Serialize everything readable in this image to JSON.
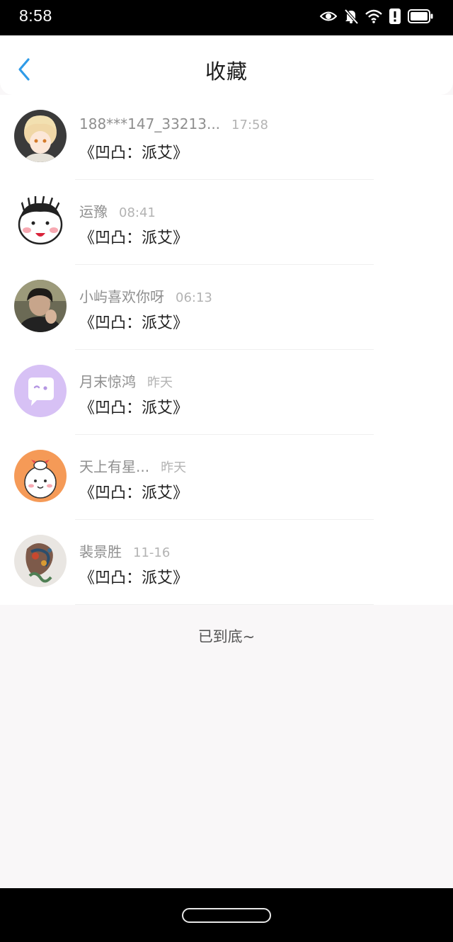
{
  "status_bar": {
    "time": "8:58",
    "icons": [
      "eye-icon",
      "bell-off-icon",
      "wifi-icon",
      "alert-icon",
      "battery-icon"
    ]
  },
  "header": {
    "back_icon": "chevron-left-icon",
    "title": "收藏"
  },
  "items": [
    {
      "user": "188***147_33213...",
      "time": "17:58",
      "title": "《凹凸：派艾》"
    },
    {
      "user": "运豫",
      "time": "08:41",
      "title": "《凹凸：派艾》"
    },
    {
      "user": "小屿喜欢你呀",
      "time": "06:13",
      "title": "《凹凸：派艾》"
    },
    {
      "user": "月末惊鸿",
      "time": "昨天",
      "title": "《凹凸：派艾》"
    },
    {
      "user": "天上有星...",
      "time": "昨天",
      "title": "《凹凸：派艾》"
    },
    {
      "user": "裴景胜",
      "time": "11-16",
      "title": "《凹凸：派艾》"
    }
  ],
  "footer": {
    "end_text": "已到底~"
  },
  "colors": {
    "accent": "#2f9be8",
    "background": "#f9f7f8",
    "username": "#8f8f8f",
    "timestamp": "#b3b3b3"
  }
}
